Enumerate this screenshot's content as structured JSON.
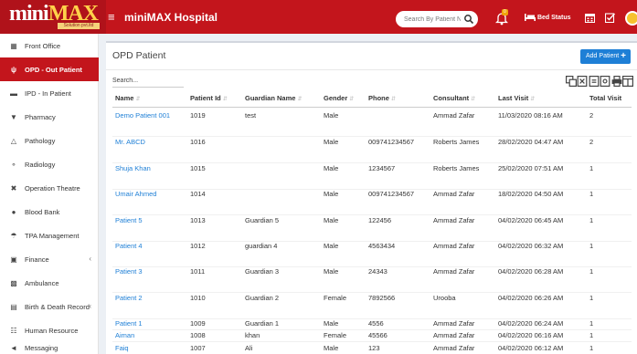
{
  "app": {
    "logo": {
      "main": "mini",
      "accent": "MAX",
      "tagline": "Solution pvt.ltd"
    },
    "title": "miniMAX Hospital"
  },
  "header": {
    "search_placeholder": "Search By Patient Name",
    "notification_count": "0",
    "bed_status": "Bed Status",
    "colors": {
      "brand": "#c3151c",
      "accent": "#1e7fd6"
    }
  },
  "sidebar": {
    "items": [
      {
        "label": "Front Office",
        "icon": "building-icon",
        "active": false
      },
      {
        "label": "OPD - Out Patient",
        "icon": "stethoscope-icon",
        "active": true
      },
      {
        "label": "IPD - In Patient",
        "icon": "bed-icon",
        "active": false
      },
      {
        "label": "Pharmacy",
        "icon": "mortar-pestle-icon",
        "active": false
      },
      {
        "label": "Pathology",
        "icon": "flask-icon",
        "active": false
      },
      {
        "label": "Radiology",
        "icon": "microscope-icon",
        "active": false
      },
      {
        "label": "Operation Theatre",
        "icon": "scissors-icon",
        "active": false
      },
      {
        "label": "Blood Bank",
        "icon": "tint-icon",
        "active": false
      },
      {
        "label": "TPA Management",
        "icon": "umbrella-icon",
        "active": false
      },
      {
        "label": "Finance",
        "icon": "money-icon",
        "active": false,
        "expandable": true
      },
      {
        "label": "Ambulance",
        "icon": "ambulance-icon",
        "active": false
      },
      {
        "label": "Birth & Death Record",
        "icon": "bank-icon",
        "active": false,
        "expandable": true
      },
      {
        "label": "Human Resource",
        "icon": "sitemap-icon",
        "active": false
      },
      {
        "label": "Messaging",
        "icon": "bullhorn-icon",
        "active": false
      }
    ]
  },
  "panel": {
    "title": "OPD Patient",
    "add_button": "Add Patient",
    "search_placeholder": "Search...",
    "toolbar_icons": [
      "copy-icon",
      "excel-icon",
      "csv-icon",
      "pdf-icon",
      "print-icon",
      "columns-icon"
    ]
  },
  "table": {
    "columns": [
      "Name",
      "Patient Id",
      "Guardian Name",
      "Gender",
      "Phone",
      "Consultant",
      "Last Visit",
      "Total Visit"
    ],
    "rows": [
      [
        "Demo Patient 001",
        "1019",
        "test",
        "Male",
        "",
        "Ammad Zafar",
        "11/03/2020 08:16 AM",
        "2"
      ],
      [
        "Mr. ABCD",
        "1016",
        "",
        "Male",
        "009741234567",
        "Roberts James",
        "28/02/2020 04:47 AM",
        "2"
      ],
      [
        "Shuja Khan",
        "1015",
        "",
        "Male",
        "1234567",
        "Roberts James",
        "25/02/2020 07:51 AM",
        "1"
      ],
      [
        "Umair Ahmed",
        "1014",
        "",
        "Male",
        "009741234567",
        "Ammad Zafar",
        "18/02/2020 04:50 AM",
        "1"
      ],
      [
        "Patient 5",
        "1013",
        "Guardian 5",
        "Male",
        "122456",
        "Ammad Zafar",
        "04/02/2020 06:45 AM",
        "1"
      ],
      [
        "Patient 4",
        "1012",
        "guardian 4",
        "Male",
        "4563434",
        "Ammad Zafar",
        "04/02/2020 06:32 AM",
        "1"
      ],
      [
        "Patient 3",
        "1011",
        "Guardian 3",
        "Male",
        "24343",
        "Ammad Zafar",
        "04/02/2020 06:28 AM",
        "1"
      ],
      [
        "Patient 2",
        "1010",
        "Guardian 2",
        "Female",
        "7892566",
        "Urooba",
        "04/02/2020 06:26 AM",
        "1"
      ],
      [
        "Patient 1",
        "1009",
        "Guardian 1",
        "Male",
        "4556",
        "Ammad Zafar",
        "04/02/2020 06:24 AM",
        "1"
      ],
      [
        "Aiman",
        "1008",
        "khan",
        "Female",
        "45566",
        "Ammad Zafar",
        "04/02/2020 06:16 AM",
        "1"
      ],
      [
        "Faiq",
        "1007",
        "Ali",
        "Male",
        "123",
        "Ammad Zafar",
        "04/02/2020 06:12 AM",
        "1"
      ]
    ]
  }
}
